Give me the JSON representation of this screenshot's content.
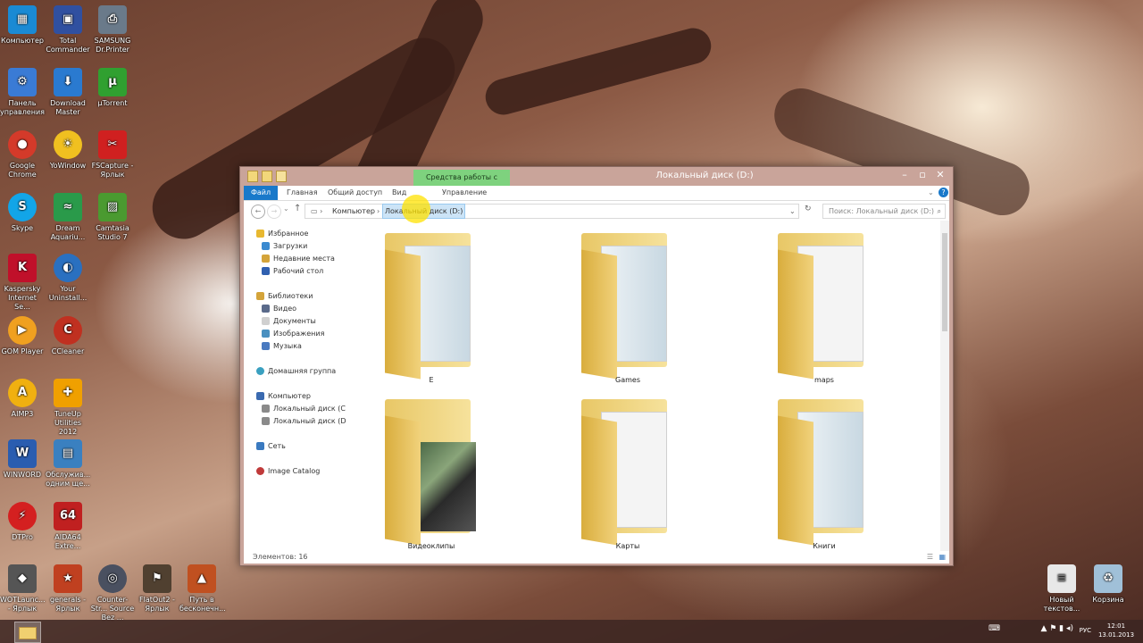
{
  "desktop": {
    "icons_col1": [
      {
        "label": "Компьютер",
        "color": "#1a8ad4"
      },
      {
        "label": "Панель управления",
        "color": "#3a7bd5"
      },
      {
        "label": "Google Chrome",
        "color": "#d43a2a"
      },
      {
        "label": "Skype",
        "color": "#12a5e8"
      },
      {
        "label": "Kaspersky Internet Se...",
        "color": "#c0102a"
      },
      {
        "label": "GOM Player",
        "color": "#f0a020"
      },
      {
        "label": "AIMP3",
        "color": "#f0b010"
      },
      {
        "label": "WINWORD",
        "color": "#2a5db0"
      },
      {
        "label": "DTPro",
        "color": "#d42020"
      },
      {
        "label": "WOTLaunc... - Ярлык",
        "color": "#555555"
      }
    ],
    "icons_col2": [
      {
        "label": "Total Commander",
        "color": "#3050a0"
      },
      {
        "label": "Download Master",
        "color": "#2a7ad0"
      },
      {
        "label": "YoWindow",
        "color": "#f0c020"
      },
      {
        "label": "Dream Aquariu...",
        "color": "#2a9a4a"
      },
      {
        "label": "Your Uninstall...",
        "color": "#2a70c0"
      },
      {
        "label": "CCleaner",
        "color": "#c03020"
      },
      {
        "label": "TuneUp Utilities 2012",
        "color": "#f0a000"
      },
      {
        "label": "Обслужив... одним щe...",
        "color": "#3a80c0"
      },
      {
        "label": "AIDA64 Extre...",
        "color": "#c02020"
      },
      {
        "label": "generals - Ярлык",
        "color": "#c04020"
      }
    ],
    "icons_col3": [
      {
        "label": "SAMSUNG Dr.Printer",
        "color": "#6a7a8a"
      },
      {
        "label": "µTorrent",
        "color": "#30a030"
      },
      {
        "label": "FSCapture - Ярлык",
        "color": "#d02020"
      },
      {
        "label": "Camtasia Studio 7",
        "color": "#4a9a30"
      }
    ],
    "bottom_row": [
      {
        "label": "Counter-Str... Source Bez ...",
        "color": "#4a5060"
      },
      {
        "label": "FlatOut2 - Ярлык",
        "color": "#504030"
      },
      {
        "label": "Путь в бесконечн...",
        "color": "#c05020"
      }
    ],
    "right_icons": [
      {
        "label": "Новый текстов...",
        "color": "#e8e8e8"
      },
      {
        "label": "Корзина",
        "color": "#a0c0d8"
      }
    ]
  },
  "window": {
    "title": "Локальный диск (D:)",
    "context_tab": "Средства работы с дисками",
    "ribbon_tabs": [
      "Файл",
      "Главная",
      "Общий доступ",
      "Вид",
      "Управление"
    ],
    "address": {
      "crumb1": "Компьютер",
      "crumb2": "Локальный диск (D:)"
    },
    "search_placeholder": "Поиск: Локальный диск (D:)",
    "nav": {
      "favorites": "Избранное",
      "downloads": "Загрузки",
      "recent": "Недавние места",
      "desktop": "Рабочий стол",
      "libraries": "Библиотеки",
      "video": "Видео",
      "documents": "Документы",
      "images": "Изображения",
      "music": "Музыка",
      "homegroup": "Домашняя группа",
      "computer": "Компьютер",
      "disk_c": "Локальный диск (C",
      "disk_d": "Локальный диск (D",
      "network": "Сеть",
      "image_catalog": "Image Catalog"
    },
    "folders": [
      "E",
      "Games",
      "maps",
      "Видеоклипы",
      "Карты",
      "Книги"
    ],
    "status": "Элементов: 16"
  },
  "taskbar": {
    "lang": "РУС",
    "time": "12:01",
    "date": "13.01.2013"
  }
}
